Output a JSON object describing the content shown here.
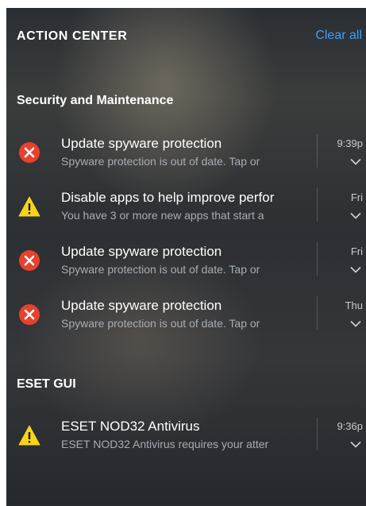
{
  "header": {
    "title": "ACTION CENTER",
    "clear_all": "Clear all"
  },
  "groups": [
    {
      "title": "Security and Maintenance",
      "notifications": [
        {
          "icon": "error-icon",
          "title": "Update spyware protection",
          "body": "Spyware protection is out of date. Tap or",
          "time": "9:39p"
        },
        {
          "icon": "warning-icon",
          "title": "Disable apps to help improve perfor",
          "body": "You have 3 or more new apps that start a",
          "time": "Fri"
        },
        {
          "icon": "error-icon",
          "title": "Update spyware protection",
          "body": "Spyware protection is out of date. Tap or",
          "time": "Fri"
        },
        {
          "icon": "error-icon",
          "title": "Update spyware protection",
          "body": "Spyware protection is out of date. Tap or",
          "time": "Thu"
        }
      ]
    },
    {
      "title": "ESET GUI",
      "notifications": [
        {
          "icon": "warning-icon",
          "title": "ESET NOD32 Antivirus",
          "body": "ESET NOD32 Antivirus requires your atter",
          "time": "9:36p"
        }
      ]
    }
  ],
  "colors": {
    "accent": "#3aa0ff",
    "error": "#e8412c",
    "warning": "#f7d41b"
  }
}
